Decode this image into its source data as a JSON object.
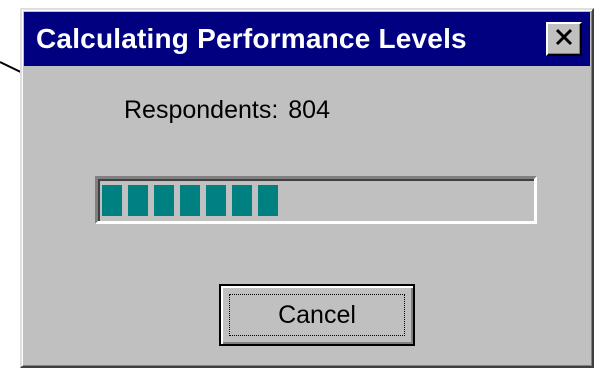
{
  "window": {
    "title": "Calculating Performance Levels",
    "close_icon": "close-icon"
  },
  "status": {
    "respondents_label": "Respondents:",
    "respondents_value": "804"
  },
  "progress": {
    "fraction": 0.42,
    "fill_color": "#008080"
  },
  "buttons": {
    "cancel_label": "Cancel"
  },
  "colors": {
    "titlebar": "#000080",
    "face": "#c0c0c0"
  }
}
